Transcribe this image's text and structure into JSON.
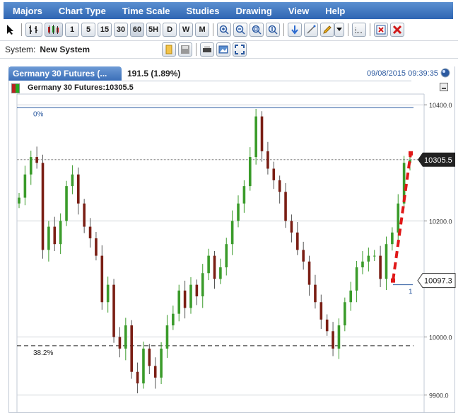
{
  "menu": [
    "Majors",
    "Chart Type",
    "Time Scale",
    "Studies",
    "Drawing",
    "View",
    "Help"
  ],
  "toolbar": {
    "interval_buttons": [
      "1",
      "5",
      "15",
      "30",
      "60",
      "5H",
      "D",
      "W",
      "M"
    ]
  },
  "system": {
    "label": "System:",
    "value": "New System"
  },
  "tab": {
    "title": "Germany 30 Futures (...",
    "change": "191.5 (1.89%)",
    "datetime": "09/08/2015 09:39:35"
  },
  "chart": {
    "symbol_label": "Germany 30 Futures:10305.5",
    "fib_0": "0%",
    "fib_382": "38.2%",
    "y_ticks": [
      "10400.0",
      "10200.0",
      "10000.0",
      "9900.0"
    ],
    "last_price": "10305.5",
    "marker_price": "10097.3",
    "marker_count": "1"
  },
  "colors": {
    "menubar": "#2f66b3",
    "up": "#3a9b2a",
    "down": "#7a1e14",
    "trendline": "#e01818"
  },
  "chart_data": {
    "type": "candlestick",
    "ylim": [
      9880,
      10410
    ],
    "y_ticks": [
      10400,
      10200,
      10000,
      9900
    ],
    "fib_levels": {
      "0%": 10395,
      "38.2%": 9985
    },
    "last_price": 10305.5,
    "marker_price": 10097.3,
    "closes": [
      10240,
      10280,
      10310,
      10300,
      10150,
      10190,
      10160,
      10200,
      10260,
      10280,
      10230,
      10190,
      10170,
      10140,
      10060,
      10090,
      10000,
      9980,
      10020,
      9940,
      9920,
      9980,
      9950,
      9930,
      9980,
      10020,
      10040,
      10080,
      10050,
      10090,
      10070,
      10110,
      10140,
      10100,
      10120,
      10160,
      10200,
      10230,
      10260,
      10310,
      10380,
      10320,
      10290,
      10270,
      10250,
      10200,
      10180,
      10150,
      10130,
      10090,
      10060,
      10030,
      10010,
      9980,
      10020,
      10060,
      10080,
      10120,
      10130,
      10140,
      10140,
      10100,
      10160,
      10180,
      10230,
      10300,
      10305
    ]
  }
}
